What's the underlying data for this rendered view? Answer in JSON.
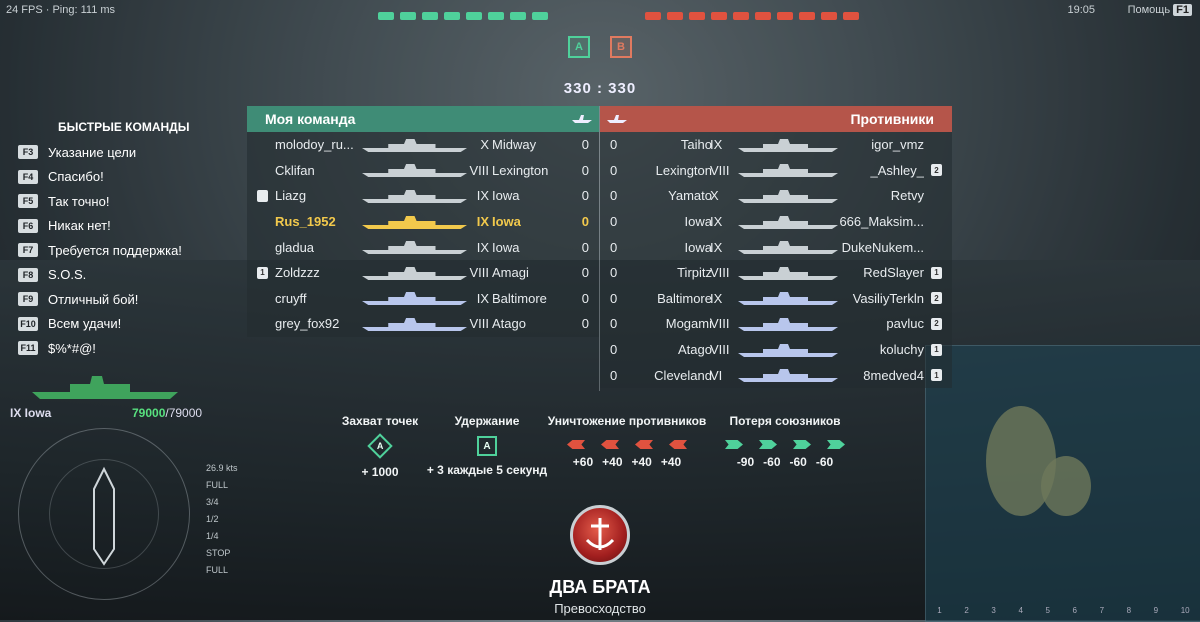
{
  "hud": {
    "fps": "24 FPS · Ping: 111 ms",
    "time": "19:05",
    "help_label": "Помощь",
    "help_key": "F1",
    "score": "330 : 330",
    "cap_ally": "A",
    "cap_enemy": "B"
  },
  "quick_commands": {
    "title": "БЫСТРЫЕ КОМАНДЫ",
    "items": [
      {
        "key": "F3",
        "label": "Указание цели"
      },
      {
        "key": "F4",
        "label": "Спасибо!"
      },
      {
        "key": "F5",
        "label": "Так точно!"
      },
      {
        "key": "F6",
        "label": "Никак нет!"
      },
      {
        "key": "F7",
        "label": "Требуется поддержка!"
      },
      {
        "key": "F8",
        "label": "S.O.S."
      },
      {
        "key": "F9",
        "label": "Отличный бой!"
      },
      {
        "key": "F10",
        "label": "Всем удачи!"
      },
      {
        "key": "F11",
        "label": "$%*#@!"
      }
    ]
  },
  "player_ship": {
    "name": "IX Iowa",
    "hp_current": "79000",
    "hp_max": "/79000",
    "speed_readout": "26.9 kts"
  },
  "speed_levels": [
    "FULL",
    "3/4",
    "1/2",
    "1/4",
    "STOP",
    "FULL"
  ],
  "my_team": {
    "title": "Моя команда",
    "players": [
      {
        "name": "molodoy_ru...",
        "tier": "X",
        "ship": "Midway",
        "frags": "0",
        "badge": "",
        "silh_color": "#c9d0d4",
        "highlight": false
      },
      {
        "name": "Cklifan",
        "tier": "VIII",
        "ship": "Lexington",
        "frags": "0",
        "badge": "",
        "silh_color": "#c9d0d4",
        "highlight": false
      },
      {
        "name": "Liazg",
        "tier": "IX",
        "ship": "Iowa",
        "frags": "0",
        "badge": "shield",
        "silh_color": "#c9d0d4",
        "highlight": false
      },
      {
        "name": "Rus_1952",
        "tier": "IX",
        "ship": "Iowa",
        "frags": "0",
        "badge": "",
        "silh_color": "#f2c94c",
        "highlight": true
      },
      {
        "name": "gladua",
        "tier": "IX",
        "ship": "Iowa",
        "frags": "0",
        "badge": "",
        "silh_color": "#c9d0d4",
        "highlight": false
      },
      {
        "name": "Zoldzzz",
        "tier": "VIII",
        "ship": "Amagi",
        "frags": "0",
        "badge": "1",
        "silh_color": "#c9d0d4",
        "highlight": false
      },
      {
        "name": "cruyff",
        "tier": "IX",
        "ship": "Baltimore",
        "frags": "0",
        "badge": "",
        "silh_color": "#b8c6ec",
        "highlight": false
      },
      {
        "name": "grey_fox92",
        "tier": "VIII",
        "ship": "Atago",
        "frags": "0",
        "badge": "",
        "silh_color": "#b8c6ec",
        "highlight": false
      }
    ]
  },
  "enemy_team": {
    "title": "Противники",
    "players": [
      {
        "name": "igor_vmz",
        "tier": "IX",
        "ship": "Taiho",
        "frags": "0",
        "badge": "",
        "silh_color": "#c9d0d4"
      },
      {
        "name": "_Ashley_",
        "tier": "VIII",
        "ship": "Lexington",
        "frags": "0",
        "badge": "2",
        "silh_color": "#c9d0d4"
      },
      {
        "name": "Retvy",
        "tier": "X",
        "ship": "Yamato",
        "frags": "0",
        "badge": "",
        "silh_color": "#c9d0d4"
      },
      {
        "name": "666_Maksim...",
        "tier": "IX",
        "ship": "Iowa",
        "frags": "0",
        "badge": "",
        "silh_color": "#c9d0d4"
      },
      {
        "name": "DukeNukem...",
        "tier": "IX",
        "ship": "Iowa",
        "frags": "0",
        "badge": "",
        "silh_color": "#c9d0d4"
      },
      {
        "name": "RedSlayer",
        "tier": "VIII",
        "ship": "Tirpitz",
        "frags": "0",
        "badge": "1",
        "silh_color": "#c9d0d4"
      },
      {
        "name": "VasiliyTerkln",
        "tier": "IX",
        "ship": "Baltimore",
        "frags": "0",
        "badge": "2",
        "silh_color": "#b8c6ec"
      },
      {
        "name": "pavluc",
        "tier": "VIII",
        "ship": "Mogami",
        "frags": "0",
        "badge": "2",
        "silh_color": "#b8c6ec"
      },
      {
        "name": "koluchy",
        "tier": "VIII",
        "ship": "Atago",
        "frags": "0",
        "badge": "1",
        "silh_color": "#b8c6ec"
      },
      {
        "name": "8medved4",
        "tier": "VI",
        "ship": "Cleveland",
        "frags": "0",
        "badge": "1",
        "silh_color": "#b8c6ec"
      }
    ]
  },
  "rules": {
    "capture": {
      "title": "Захват точек",
      "icon_letter": "A",
      "value": "+ 1000"
    },
    "hold": {
      "title": "Удержание",
      "icon_letter": "A",
      "value": "+ 3 каждые 5 секунд"
    },
    "kill": {
      "title": "Уничтожение противников",
      "values": [
        "+60",
        "+40",
        "+40",
        "+40"
      ],
      "color": "#e0523f"
    },
    "loss": {
      "title": "Потеря союзников",
      "values": [
        "-90",
        "-60",
        "-60",
        "-60"
      ],
      "color": "#4fd19b"
    }
  },
  "achievement": {
    "title": "ДВА БРАТА",
    "subtitle": "Превосходство"
  },
  "colors": {
    "ally": "#3f8c76",
    "enemy": "#b5554a",
    "self": "#f2c94c"
  }
}
